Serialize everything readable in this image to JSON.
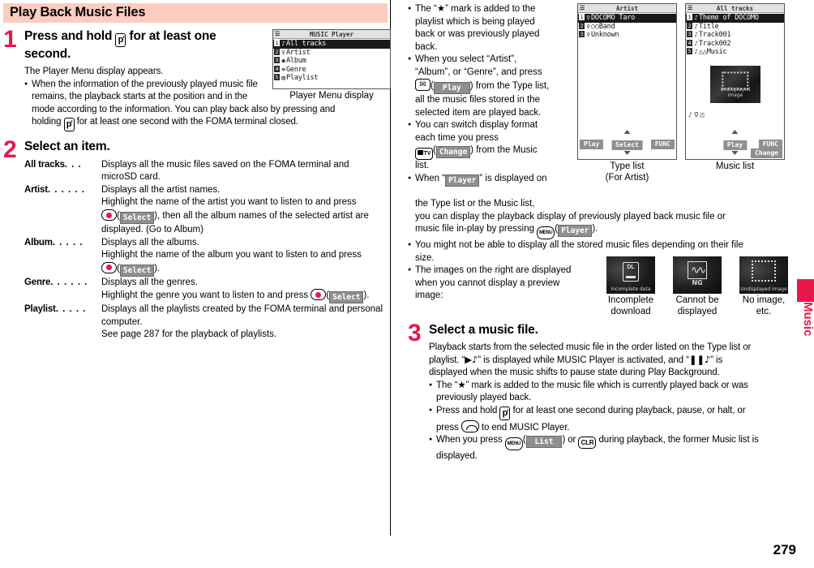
{
  "page": {
    "number": "279",
    "side_tab_label": "Music"
  },
  "section": {
    "banner_title": "Play Back Music Files"
  },
  "steps": [
    {
      "number": "1",
      "title": "Press and hold ① for at least one second.",
      "title_part1": "Press and hold",
      "title_part2": "for at least one",
      "title_part3": "second.",
      "lead": "The Player Menu display appears.",
      "bullets": [
        "When the information of the previously played music file remains, the playback starts at the position and in the mode according to the information. You can play back also by pressing and holding ① for at least one second with the FOMA terminal closed."
      ],
      "bullet1_a": "When the information of the previously played music file",
      "bullet1_b": "remains, the playback starts at the position and in the",
      "bullet1_c": "mode according to the information. You can play back also by pressing and",
      "bullet1_d1": "holding",
      "bullet1_d2": "for at least one second with the FOMA terminal closed."
    },
    {
      "number": "2",
      "title": "Select an item.",
      "definitions": [
        {
          "term": "All tracks",
          "dots": ". . .",
          "lines": [
            "Displays all the music files saved on the FOMA terminal and",
            "microSD card."
          ]
        },
        {
          "term": "Artist",
          "dots": ". . . . . .",
          "lines": [
            "Displays all the artist names.",
            "Highlight the name of the artist you want to listen to and press",
            "SELECTKEY, then all the album names of the selected artist are",
            "displayed. (Go to Album)"
          ]
        },
        {
          "term": "Album",
          "dots": ". . . . .",
          "lines": [
            "Displays all the albums.",
            "Highlight the name of the album you want to listen to and press",
            "SELECTKEY."
          ]
        },
        {
          "term": "Genre",
          "dots": ". . . . . .",
          "lines": [
            "Displays all the genres.",
            "Highlight the genre you want to listen to and press SELECTKEY."
          ]
        },
        {
          "term": "Playlist",
          "dots": ". . . . .",
          "lines": [
            "Displays all the playlists created by the FOMA terminal and personal",
            "computer.",
            "See page 287 for the playback of playlists."
          ]
        }
      ]
    },
    {
      "number": "3",
      "title": "Select a music file.",
      "lead_a": "Playback starts from the selected music file in the order listed on the Type list or",
      "lead_b1": "playlist. “",
      "lead_b2": "” is displayed while MUSIC Player is activated, and “",
      "lead_b3": "” is",
      "lead_c": "displayed when the music shifts to pause state during Play Background.",
      "bullets": [
        "The “★” mark is added to the music file which is currently played back or was previously played back.",
        "Press and hold ① for at least one second during playback, pause, or halt, or press ② to end MUSIC Player.",
        "When you press MENU(List) or CLR during playback, the former Music list is displayed."
      ],
      "b1_a": "The “★” mark is added to the music file which is currently played back or was",
      "b1_b": "previously played back.",
      "b2_a": "Press and hold",
      "b2_b": "for at least one second during playback, pause, or halt, or",
      "b2_c": "press",
      "b2_d": "to end MUSIC Player.",
      "b3_a": "When you press",
      "b3_b": ") or",
      "b3_c": "during playback, the former Music list is",
      "b3_d": "displayed."
    }
  ],
  "right_notes": {
    "n1_a": "The “★” mark is added to the",
    "n1_b": "playlist which is being played",
    "n1_c": "back or was previously played",
    "n1_d": "back.",
    "n2_a": "When you select “Artist”,",
    "n2_b": "“Album”, or “Genre”, and press",
    "n2_c": ") from the Type list,",
    "n2_d": "all the music files stored in the",
    "n2_e": "selected item are played back.",
    "n3_a": "You can switch display format",
    "n3_b": "each time you press",
    "n3_c": ") from the Music",
    "n3_d": "list.",
    "n4_a": "When “",
    "n4_b": "” is displayed on",
    "n4_c": "the Type list or the Music list,",
    "n4_d": "you can display the playback display of previously played back music file or",
    "n4_e": "music file in-play by pressing",
    "n4_f": ").",
    "n5_a": "You might not be able to display all the stored music files depending on their file",
    "n5_b": "size.",
    "n6_a": "The images on the right are displayed",
    "n6_b": "when you cannot display a preview",
    "n6_c": "image:"
  },
  "softkey_labels": {
    "select": "Select",
    "play": "Play",
    "change": "Change",
    "player": "Player",
    "list": "List",
    "func": "FUNC"
  },
  "key_labels": {
    "music_key": "p",
    "menu": "MENU",
    "clr": "CLR",
    "camera_tv": "TV"
  },
  "screens": {
    "player_menu": {
      "caption": "Player Menu display",
      "status_title": "MUSIC Player",
      "rows": [
        {
          "num": "1",
          "icon": "♪",
          "label": "All tracks",
          "selected": true
        },
        {
          "num": "2",
          "icon": "♀",
          "label": "Artist",
          "selected": false
        },
        {
          "num": "3",
          "icon": "◉",
          "label": "Album",
          "selected": false
        },
        {
          "num": "4",
          "icon": "≡",
          "label": "Genre",
          "selected": false
        },
        {
          "num": "5",
          "icon": "▤",
          "label": "Playlist",
          "selected": false
        }
      ]
    },
    "type_list": {
      "caption_line1": "Type list",
      "caption_line2": "(For Artist)",
      "status_title": "Artist",
      "rows": [
        {
          "num": "1",
          "icon": "♀",
          "label": "DOCOMO Taro",
          "selected": true
        },
        {
          "num": "2",
          "icon": "♀",
          "label": "○○Band",
          "selected": false
        },
        {
          "num": "3",
          "icon": "♀",
          "label": "Unknown",
          "selected": false
        }
      ],
      "softkey_left": "Play",
      "softkey_center": "Select",
      "softkey_right": "FUNC"
    },
    "music_list": {
      "caption": "Music list",
      "status_title": "All tracks",
      "rows": [
        {
          "num": "1",
          "icon": "♪",
          "label": "Theme of DOCOMO",
          "selected": true
        },
        {
          "num": "2",
          "icon": "♪",
          "label": "Title",
          "selected": false
        },
        {
          "num": "3",
          "icon": "♪",
          "label": "Track001",
          "selected": false
        },
        {
          "num": "4",
          "icon": "♪",
          "label": "Track002",
          "selected": false
        },
        {
          "num": "5",
          "icon": "♪",
          "label": "△△Music",
          "selected": false
        }
      ],
      "thumb_label_line1": "Undisplayed",
      "thumb_label_line2": "image",
      "softkey_center": "Play",
      "softkey_right_top": "FUNC",
      "softkey_right_bottom": "Change"
    }
  },
  "preview_icons": [
    {
      "glyph": "DL",
      "sub": "Incomplete data",
      "caption_line1": "Incomplete",
      "caption_line2": "download"
    },
    {
      "glyph": "NG",
      "sub": "NG",
      "caption_line1": "Cannot be",
      "caption_line2": "displayed"
    },
    {
      "glyph": "UD",
      "sub": "Undisplayed image",
      "caption_line1": "No image,",
      "caption_line2": "etc."
    }
  ],
  "colors": {
    "banner_bg": "#fbcdc0",
    "accent_red": "#e8174a",
    "softkey_grey": "#8f8f8f"
  }
}
